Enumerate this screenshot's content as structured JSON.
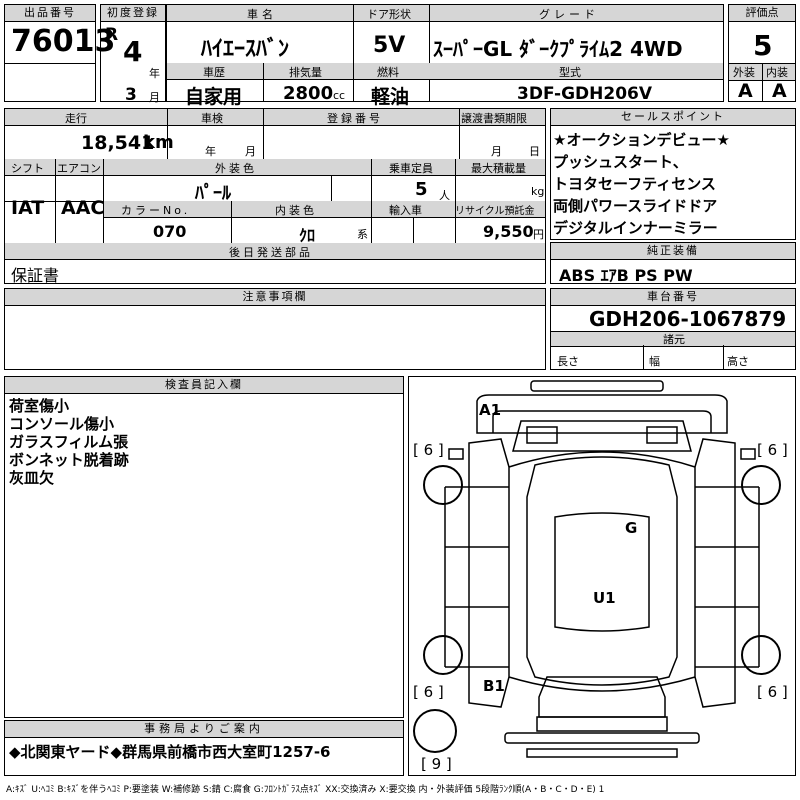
{
  "header": {
    "lot_label": "出品番号",
    "lot_no": "76013",
    "first_reg_label": "初度登録",
    "era": "R",
    "year": "4",
    "year_unit": "年",
    "month": "3",
    "month_unit": "月",
    "name_label": "車名",
    "name": "ﾊｲｴｰｽﾊﾞﾝ",
    "door_label": "ドア形状",
    "door": "5V",
    "grade_label": "グレード",
    "grade": "ｽｰﾊﾟｰGL ﾀﾞｰｸﾌﾟﾗｲﾑ2 4WD",
    "score_label": "評価点",
    "score": "5",
    "history_label": "車歴",
    "history": "自家用",
    "displacement_label": "排気量",
    "displacement": "2800",
    "displacement_unit": "cc",
    "fuel_label": "燃料",
    "fuel": "軽油",
    "model_label": "型式",
    "model": "3DF-GDH206V",
    "ext_label": "外装",
    "ext": "A",
    "int_label": "内装",
    "int": "A"
  },
  "details": {
    "mileage_label": "走行",
    "mileage": "18,541",
    "mileage_unit": "km",
    "inspection_label": "車検",
    "insp_year_unit": "年",
    "insp_month_unit": "月",
    "plate_label": "登録番号",
    "transfer_label": "譲渡書類期限",
    "transfer_month_unit": "月",
    "transfer_day_unit": "日",
    "shift_label": "シフト",
    "shift": "IAT",
    "ac_label": "エアコン",
    "ac": "AAC",
    "color_label": "外装色",
    "color": "ﾊﾟｰﾙ",
    "capacity_label": "乗車定員",
    "capacity": "5",
    "capacity_unit": "人",
    "load_label": "最大積載量",
    "load_unit": "kg",
    "colorno_label": "カラーNo.",
    "colorno": "070",
    "intcolor_label": "内装色",
    "intcolor": "ｸﾛ",
    "intcolor_unit": "系",
    "import_label": "輸入車",
    "recycle_label": "リサイクル預託金",
    "recycle": "9,550",
    "recycle_unit": "円",
    "later_label": "後日発送部品",
    "later": "保証書"
  },
  "sales": {
    "label": "セールスポイント",
    "lines": [
      "★オークションデビュー★",
      "プッシュスタート、",
      "トヨタセーフティセンス",
      "両側パワースライドドア",
      "デジタルインナーミラー"
    ]
  },
  "equipment": {
    "label": "純正装備",
    "value": "ABS ｴｱB PS PW"
  },
  "notes": {
    "label": "注意事項欄"
  },
  "chassis": {
    "label": "車台番号",
    "value": "GDH206-1067879"
  },
  "specs": {
    "label": "諸元",
    "length": "長さ",
    "width": "幅",
    "height": "高さ"
  },
  "inspector": {
    "label": "検査員記入欄",
    "lines": [
      "荷室傷小",
      "コンソール傷小",
      "ガラスフィルム張",
      "ボンネット脱着跡",
      "灰皿欠"
    ]
  },
  "office": {
    "label": "事務局よりご案内",
    "text": "◆北関東ヤード◆群馬県前橋市西大室町1257-6"
  },
  "diagram": {
    "a1": "A1",
    "g": "G",
    "u1": "U1",
    "b1": "B1",
    "tire_fl": "[ 6 ]",
    "tire_fr": "[ 6 ]",
    "tire_rl": "[ 6 ]",
    "tire_rr": "[ 6 ]",
    "spare": "[ 9 ]"
  },
  "legend": "A:ｷｽﾞ U:ﾍｺﾐ B:ｷｽﾞを伴うﾍｺﾐ P:要塗装 W:補修跡 S:錆 C:腐食 G:ﾌﾛﾝﾄｶﾞﾗｽ点ｷｽﾞ XX:交換済み X:要交換  内・外装評価 5段階ﾗﾝｸ順(A・B・C・D・E) 1"
}
